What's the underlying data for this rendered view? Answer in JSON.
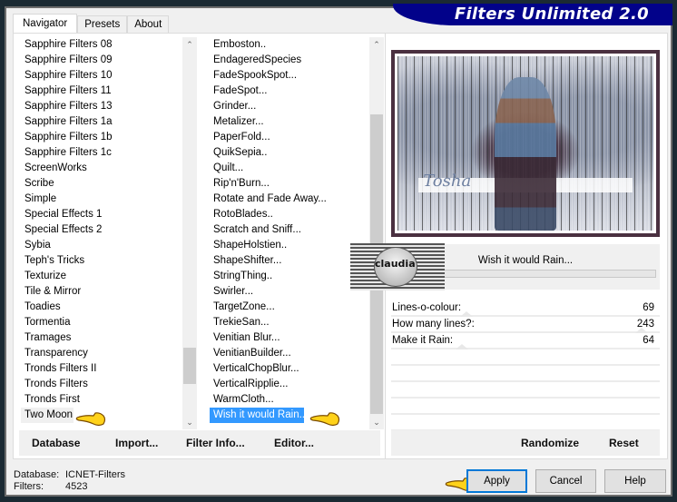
{
  "window": {
    "title": "Filters Unlimited 2.0"
  },
  "tabs": [
    {
      "label": "Navigator",
      "active": true
    },
    {
      "label": "Presets",
      "active": false
    },
    {
      "label": "About",
      "active": false
    }
  ],
  "categories": {
    "items": [
      "Sapphire Filters 08",
      "Sapphire Filters 09",
      "Sapphire Filters 10",
      "Sapphire Filters 11",
      "Sapphire Filters 13",
      "Sapphire Filters 1a",
      "Sapphire Filters 1b",
      "Sapphire Filters 1c",
      "ScreenWorks",
      "Scribe",
      "Simple",
      "Special Effects 1",
      "Special Effects 2",
      "Sybia",
      "Teph's Tricks",
      "Texturize",
      "Tile & Mirror",
      "Toadies",
      "Tormentia",
      "Tramages",
      "Transparency",
      "Tronds Filters II",
      "Tronds Filters",
      "Tronds First",
      "Two Moon"
    ],
    "selected": "Two Moon"
  },
  "filters": {
    "items": [
      "Emboston..",
      "EndageredSpecies",
      "FadeSpookSpot...",
      "FadeSpot...",
      "Grinder...",
      "Metalizer...",
      "PaperFold...",
      "QuikSepia..",
      "Quilt...",
      "Rip'n'Burn...",
      "Rotate and Fade Away...",
      "RotoBlades..",
      "Scratch and Sniff...",
      "ShapeHolstien..",
      "ShapeShifter...",
      "StringThing..",
      "Swirler...",
      "TargetZone...",
      "TrekieSan...",
      "Venitian Blur...",
      "VenitianBuilder...",
      "VerticalChopBlur...",
      "VerticalRipplie...",
      "WarmCloth...",
      "Wish it would Rain..."
    ],
    "selected": "Wish it would Rain..."
  },
  "left_buttons": {
    "database": "Database",
    "import": "Import...",
    "filter_info": "Filter Info...",
    "editor": "Editor..."
  },
  "preview": {
    "signature": "Tosha",
    "watermark": "claudia"
  },
  "filter_name": "Wish it would Rain...",
  "parameters": [
    {
      "label": "Lines-o-colour:",
      "value": 69
    },
    {
      "label": "How many lines?:",
      "value": 243
    },
    {
      "label": "Make it Rain:",
      "value": 64
    }
  ],
  "right_buttons": {
    "randomize": "Randomize",
    "reset": "Reset"
  },
  "status": {
    "database_label": "Database:",
    "database_value": "ICNET-Filters",
    "filters_label": "Filters:",
    "filters_value": "4523"
  },
  "dialog_buttons": {
    "apply": "Apply",
    "cancel": "Cancel",
    "help": "Help"
  },
  "colors": {
    "banner": "#02028a",
    "selection": "#3399ff",
    "primary_border": "#0078d7"
  }
}
